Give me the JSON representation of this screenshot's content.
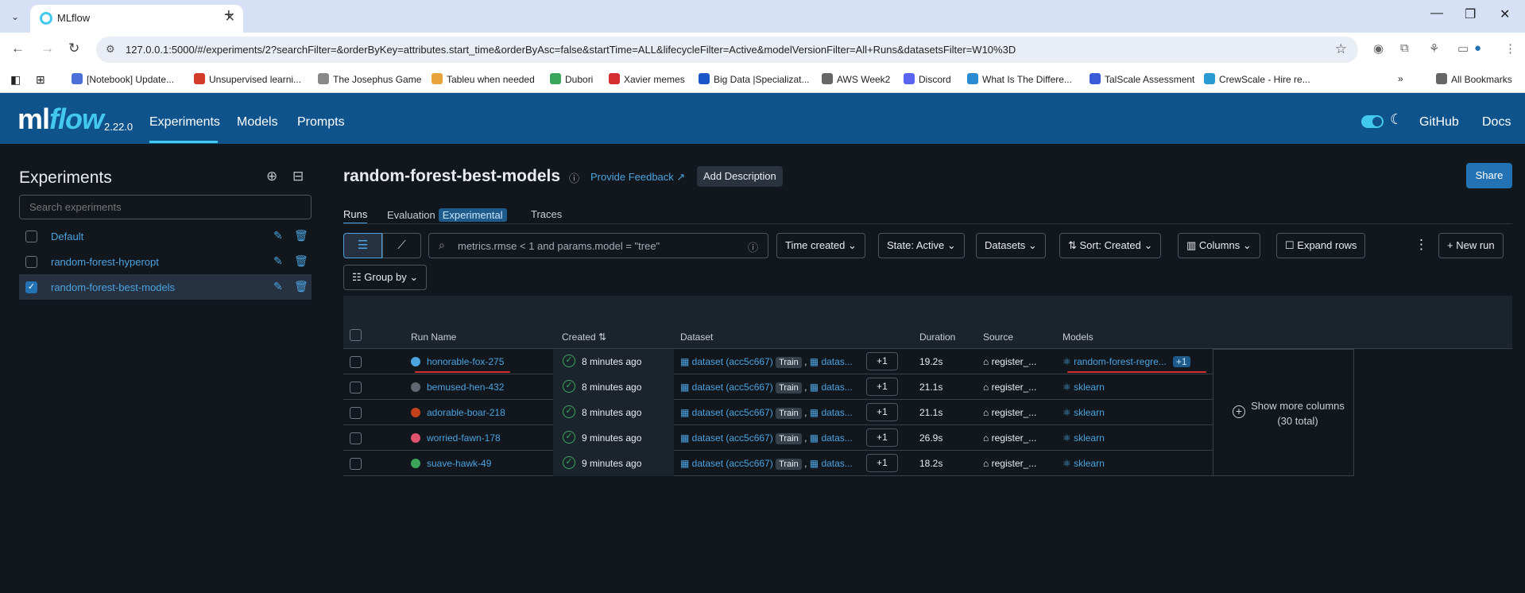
{
  "browser": {
    "tab_title": "MLflow",
    "url": "127.0.0.1:5000/#/experiments/2?searchFilter=&orderByKey=attributes.start_time&orderByAsc=false&startTime=ALL&lifecycleFilter=Active&modelVersionFilter=All+Runs&datasetsFilter=W10%3D",
    "bookmarks": [
      "[Notebook] Update...",
      "Unsupervised learni...",
      "The Josephus Game",
      "Tableu when needed",
      "Dubori",
      "Xavier memes",
      "Big Data |Specializat...",
      "AWS Week2",
      "Discord",
      "What Is The Differe...",
      "TalScale Assessment",
      "CrewScale - Hire re..."
    ],
    "all_bookmarks": "All Bookmarks"
  },
  "header": {
    "logo": "mlflow",
    "version": "2.22.0",
    "nav": [
      "Experiments",
      "Models",
      "Prompts"
    ],
    "github": "GitHub",
    "docs": "Docs"
  },
  "sidebar": {
    "title": "Experiments",
    "search_placeholder": "Search experiments",
    "items": [
      {
        "name": "Default",
        "checked": false
      },
      {
        "name": "random-forest-hyperopt",
        "checked": false
      },
      {
        "name": "random-forest-best-models",
        "checked": true
      }
    ]
  },
  "main": {
    "title": "random-forest-best-models",
    "feedback": "Provide Feedback",
    "add_description": "Add Description",
    "share": "Share",
    "tabs": [
      "Runs",
      "Evaluation",
      "Traces"
    ],
    "experimental_badge": "Experimental",
    "filter_placeholder": "metrics.rmse < 1 and params.model = \"tree\"",
    "controls": {
      "time": "Time created",
      "state": "State: Active",
      "datasets": "Datasets",
      "sort": "Sort: Created",
      "columns": "Columns",
      "expand": "Expand rows",
      "new_run": "New run",
      "group_by": "Group by"
    }
  },
  "table": {
    "headers": [
      "Run Name",
      "Created",
      "Dataset",
      "Duration",
      "Source",
      "Models"
    ],
    "rows": [
      {
        "name": "honorable-fox-275",
        "color": "#4ca3e0",
        "created": "8 minutes ago",
        "dataset": "dataset (acc5c667)",
        "tag": "Train",
        "dataset2": "datas...",
        "more": "+1",
        "duration": "19.2s",
        "source": "register_...",
        "model": "random-forest-regre...",
        "model_more": "+1"
      },
      {
        "name": "bemused-hen-432",
        "color": "#5f6872",
        "created": "8 minutes ago",
        "dataset": "dataset (acc5c667)",
        "tag": "Train",
        "dataset2": "datas...",
        "more": "+1",
        "duration": "21.1s",
        "source": "register_...",
        "model": "sklearn",
        "model_more": ""
      },
      {
        "name": "adorable-boar-218",
        "color": "#c2411b",
        "created": "8 minutes ago",
        "dataset": "dataset (acc5c667)",
        "tag": "Train",
        "dataset2": "datas...",
        "more": "+1",
        "duration": "21.1s",
        "source": "register_...",
        "model": "sklearn",
        "model_more": ""
      },
      {
        "name": "worried-fawn-178",
        "color": "#e0516e",
        "created": "9 minutes ago",
        "dataset": "dataset (acc5c667)",
        "tag": "Train",
        "dataset2": "datas...",
        "more": "+1",
        "duration": "26.9s",
        "source": "register_...",
        "model": "sklearn",
        "model_more": ""
      },
      {
        "name": "suave-hawk-49",
        "color": "#3ba55c",
        "created": "9 minutes ago",
        "dataset": "dataset (acc5c667)",
        "tag": "Train",
        "dataset2": "datas...",
        "more": "+1",
        "duration": "18.2s",
        "source": "register_...",
        "model": "sklearn",
        "model_more": ""
      }
    ],
    "show_more": "Show more columns (30 total)"
  }
}
